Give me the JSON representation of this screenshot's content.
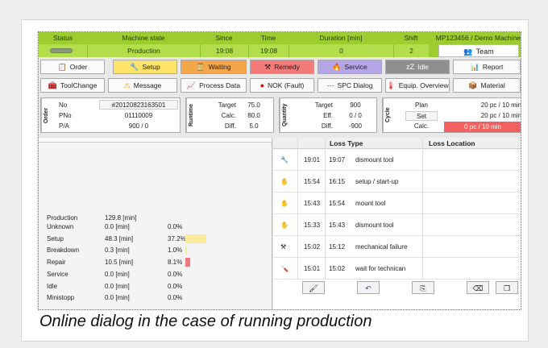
{
  "header": {
    "labels": [
      "Status",
      "Machine state",
      "Since",
      "Time",
      "Duration [min]",
      "Shift"
    ],
    "values": [
      "Production",
      "19:08",
      "19:08",
      "0",
      "2"
    ],
    "machine": "MP123456 / Demo Machine",
    "team_label": "Team"
  },
  "row1": [
    "Order",
    "Setup",
    "Waiting",
    "Remedy",
    "Service",
    "Idle",
    "Report"
  ],
  "row2": [
    "ToolChange",
    "Message",
    "Process Data",
    "NOK (Fault)",
    "SPC Dialog",
    "Equip. Overview",
    "Material"
  ],
  "order": {
    "title": "Order",
    "labels": [
      "No",
      "PNo",
      "P/A"
    ],
    "values": [
      "#20120823163501",
      "01110009",
      "900 / 0"
    ]
  },
  "runtime": {
    "title": "Runtime",
    "labels": [
      "Target",
      "Calc.",
      "Diff."
    ],
    "values": [
      "75.0",
      "80.0",
      "5.0"
    ]
  },
  "quantity": {
    "title": "Quantity",
    "labels": [
      "Target",
      "Eff.",
      "Diff."
    ],
    "values": [
      "900",
      "0 / 0",
      "-900"
    ]
  },
  "cycle": {
    "title": "Cycle",
    "labels": [
      "Plan",
      "Set",
      "Calc."
    ],
    "values": [
      "20 pc / 10 min",
      "20 pc / 10 min",
      "0 pc / 10 min"
    ]
  },
  "durations": [
    {
      "name": "Production",
      "time": "129.8 [min]",
      "pct": ""
    },
    {
      "name": "Unknown",
      "time": "0.0 [min]",
      "pct": "0.0%"
    },
    {
      "name": "Setup",
      "time": "48.3 [min]",
      "pct": "37.2%"
    },
    {
      "name": "Breakdown",
      "time": "0.3 [min]",
      "pct": "1.0%"
    },
    {
      "name": "Repair",
      "time": "10.5 [min]",
      "pct": "8.1%"
    },
    {
      "name": "Service",
      "time": "0.0 [min]",
      "pct": "0.0%"
    },
    {
      "name": "Idle",
      "time": "0.0 [min]",
      "pct": "0.0%"
    },
    {
      "name": "Ministopp",
      "time": "0.0 [min]",
      "pct": "0.0%"
    }
  ],
  "bars": {
    "setup_fraction": 0.372,
    "breakdown_fraction": 0.01,
    "repair_fraction": 0.081,
    "setup_color": "#fde99a",
    "breakdown_color": "#fde99a",
    "repair_color": "#f07a7a"
  },
  "losses": {
    "headers": [
      "Loss Type",
      "Loss Location"
    ],
    "rows": [
      {
        "icon": "wrench-icon",
        "start": "19:01",
        "end": "19:07",
        "type": "dismount tool"
      },
      {
        "icon": "hand-icon",
        "start": "15:54",
        "end": "16:15",
        "type": "setup / start-up"
      },
      {
        "icon": "hand-icon",
        "start": "15:43",
        "end": "15:54",
        "type": "mount tool"
      },
      {
        "icon": "hand-icon",
        "start": "15:33",
        "end": "15:43",
        "type": "dismount tool"
      },
      {
        "icon": "hammer-icon",
        "start": "15:02",
        "end": "15:12",
        "type": "mechanical failure"
      },
      {
        "icon": "screwdriver-icon",
        "start": "15:01",
        "end": "15:02",
        "type": "wait for technican"
      }
    ]
  },
  "caption": "Online dialog in the case of running production",
  "colors": {
    "header_green": "#9bcd2f",
    "setup_yellow": "#fde36a",
    "waiting_orange": "#f4a64a",
    "remedy_red": "#f47a7a",
    "service_purple": "#b4a6e6",
    "idle_gray": "#8f8f8f",
    "calc_red": "#f26060"
  }
}
